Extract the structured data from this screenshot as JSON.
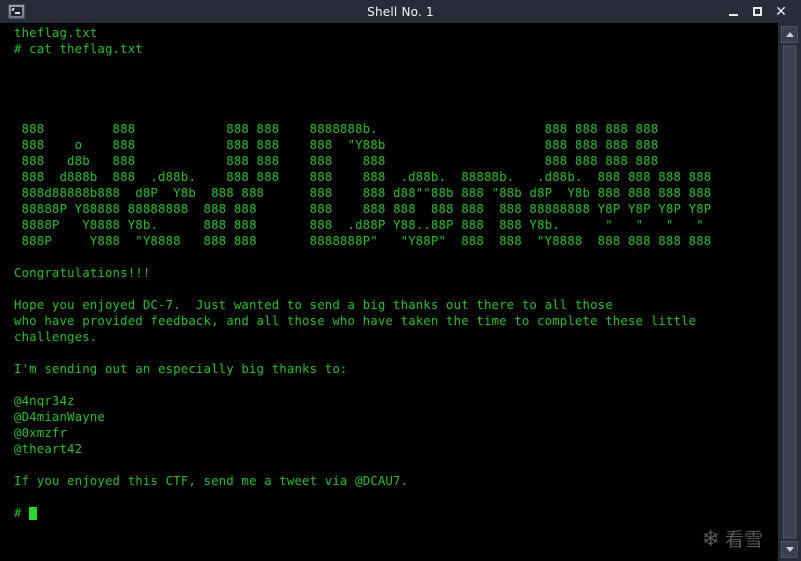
{
  "window": {
    "title": "Shell No. 1",
    "icon": "terminal-icon",
    "controls": {
      "minimize": "_",
      "maximize": "□",
      "close": "✕"
    },
    "colors": {
      "titlebar_bg": "#282c38",
      "terminal_bg": "#000000",
      "terminal_fg": "#19c419",
      "title_fg": "#f2f4f8"
    }
  },
  "scrollbar": {
    "up_arrow": "scroll-up-arrow",
    "down_arrow": "scroll-down-arrow"
  },
  "watermark": {
    "glyph": "❄",
    "text": "看雪"
  },
  "terminal": {
    "lines_before": [
      "theflag.txt",
      "# cat theflag.txt",
      "",
      "",
      "",
      ""
    ],
    "banner": [
      "888         888            888 888    8888888b.                      888 888 888 888",
      "888    o    888            888 888    888  \"Y88b                     888 888 888 888",
      "888   d8b   888            888 888    888    888                     888 888 888 888",
      "888  d888b  888  .d88b.    888 888    888    888  .d88b.  88888b.   .d88b.  888 888 888 888",
      "888d88888b888  d8P  Y8b 888 888       888    888 d88\"\"88b 888 \"88b d8P  Y8b 888 888 888 888",
      "88888P Y88888 88888888 888 888       888    888 888  888 888  888 88888888 Y8P Y8P Y8P Y8P",
      "8888P   Y8888 Y8b.     888 888       888  .d88P Y88..88P 888  888 Y8b.      \"   \"   \"   \" ",
      "888P     Y888  \"Y8888  888 888       8888888P\"   \"Y88P\"  888  888  \"Y8888  888 888 888 888"
    ],
    "message": [
      "",
      "Congratulations!!!",
      "",
      "Hope you enjoyed DC-7.  Just wanted to send a big thanks out there to all those",
      "who have provided feedback, and all those who have taken the time to complete these little",
      "challenges.",
      "",
      "I'm sending out an especially big thanks to:",
      "",
      "@4nqr34z",
      "@D4mianWayne",
      "@0xmzfr",
      "@theart42",
      "",
      "If you enjoyed this CTF, send me a tweet via @DCAU7.",
      ""
    ],
    "prompt": "# ",
    "cursor_visible": true,
    "full_text": "theflag.txt\n# cat theflag.txt\n\n\n\n\n 888         888            888 888    8888888b.                      888 888 888 888\n 888    o    888            888 888    888  \"Y88b                     888 888 888 888\n 888   d8b   888            888 888    888    888                     888 888 888 888\n 888  d888b  888  .d88b.    888 888    888    888  .d88b.  88888b.   .d88b.  888 888 888 888\n 888d88888b888  d8P  Y8b  888 888      888    888 d88\"\"88b 888 \"88b d8P  Y8b 888 888 888 888\n 88888P Y88888 88888888  888 888       888    888 888  888 888  888 88888888 Y8P Y8P Y8P Y8P\n 8888P   Y8888 Y8b.      888 888       888  .d88P Y88..88P 888  888 Y8b.      \"   \"   \"   \"\n 888P     Y888  \"Y8888   888 888       8888888P\"   \"Y88P\"  888  888  \"Y8888  888 888 888 888\n\nCongratulations!!!\n\nHope you enjoyed DC-7.  Just wanted to send a big thanks out there to all those\nwho have provided feedback, and all those who have taken the time to complete these little\nchallenges.\n\nI'm sending out an especially big thanks to:\n\n@4nqr34z\n@D4mianWayne\n@0xmzfr\n@theart42\n\nIf you enjoyed this CTF, send me a tweet via @DCAU7.\n\n# "
  }
}
